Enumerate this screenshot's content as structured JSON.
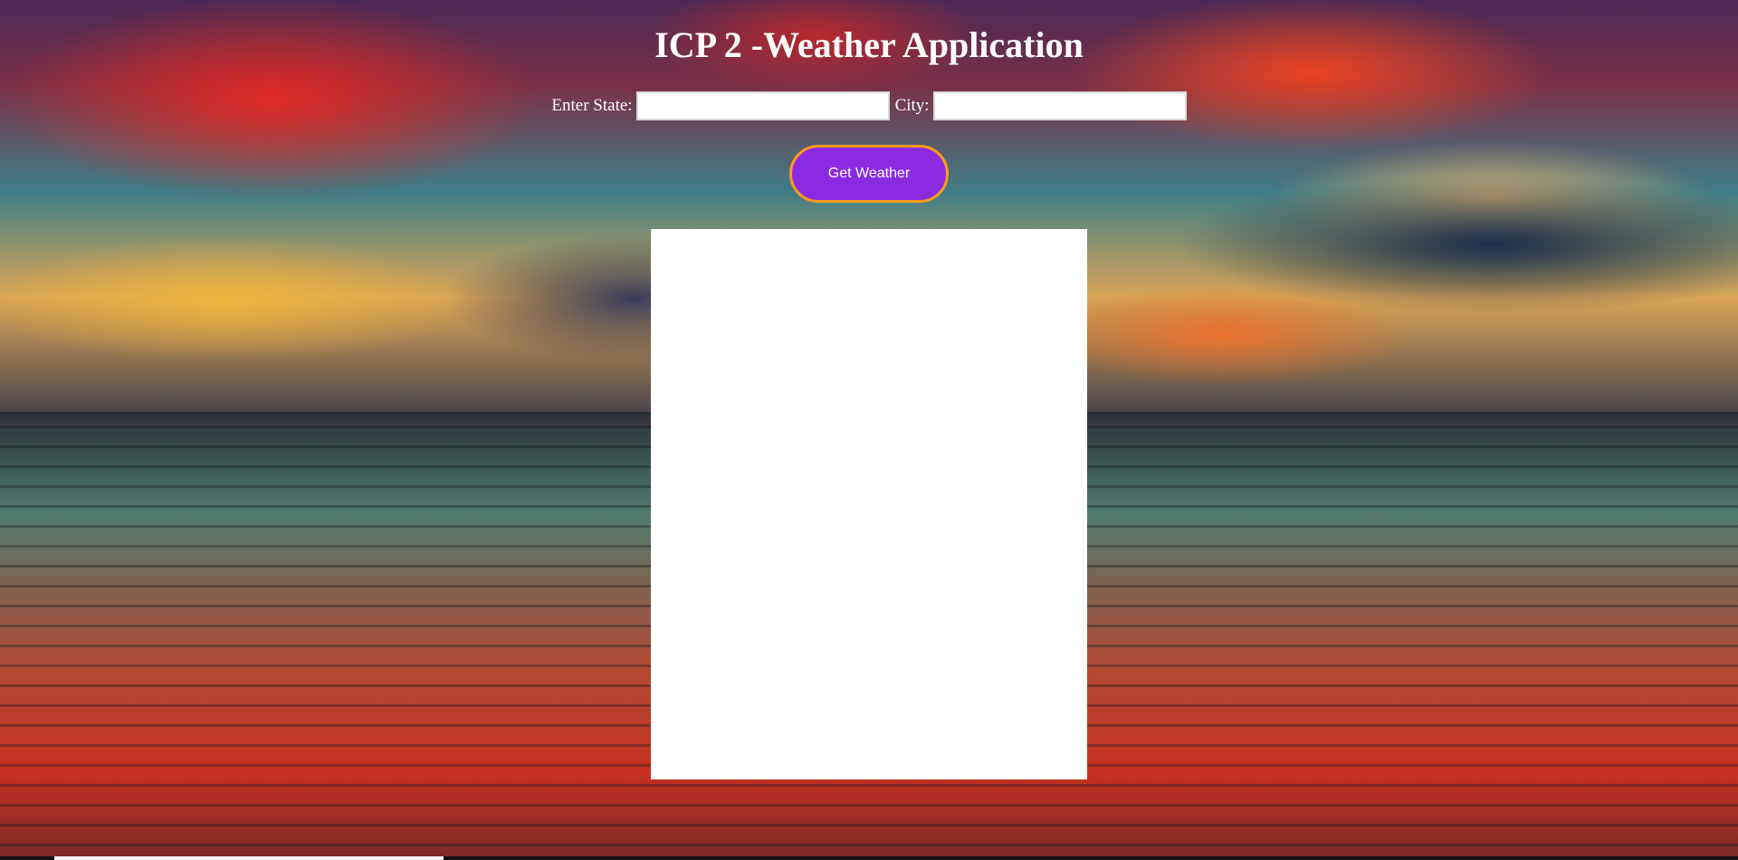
{
  "page": {
    "title": "ICP 2 -Weather Application"
  },
  "form": {
    "state_label": "Enter State:",
    "state_value": "",
    "city_label": "City:",
    "city_value": ""
  },
  "actions": {
    "get_weather_label": "Get Weather"
  },
  "colors": {
    "button_background": "#8a2be2",
    "button_border": "#ff9a1a",
    "result_panel": "#ffffff",
    "title_text": "#ffffff"
  },
  "background": {
    "description_icon": "sunset-seascape-image"
  }
}
